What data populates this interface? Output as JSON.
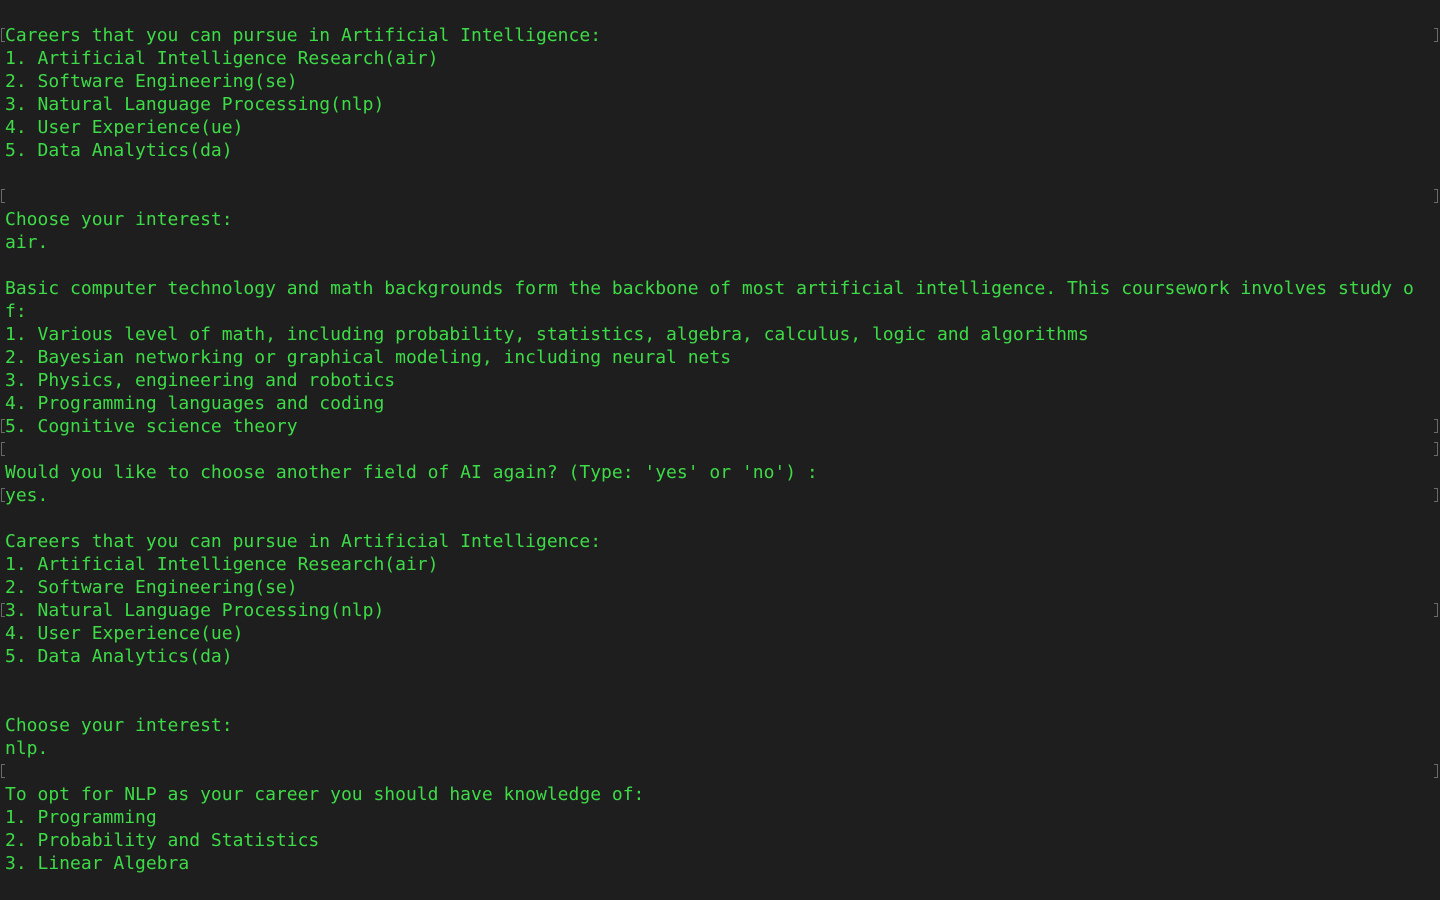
{
  "theme": {
    "background": "#1e1e1e",
    "text_color": "#3ddc47",
    "marker_color": "#6a6a6a"
  },
  "terminal": {
    "lines": [
      {
        "text": "Careers that you can pursue in Artificial Intelligence:",
        "marked": true
      },
      {
        "text": "1. Artificial Intelligence Research(air)",
        "marked": false
      },
      {
        "text": "2. Software Engineering(se)",
        "marked": false
      },
      {
        "text": "3. Natural Language Processing(nlp)",
        "marked": false
      },
      {
        "text": "4. User Experience(ue)",
        "marked": false
      },
      {
        "text": "5. Data Analytics(da)",
        "marked": false
      },
      {
        "text": "",
        "marked": false
      },
      {
        "text": "",
        "marked": true
      },
      {
        "text": "Choose your interest:",
        "marked": false
      },
      {
        "text": "air.",
        "marked": false
      },
      {
        "text": "",
        "marked": false
      },
      {
        "text": "Basic computer technology and math backgrounds form the backbone of most artificial intelligence. This coursework involves study o",
        "marked": false
      },
      {
        "text": "f:",
        "marked": false
      },
      {
        "text": "1. Various level of math, including probability, statistics, algebra, calculus, logic and algorithms",
        "marked": false
      },
      {
        "text": "2. Bayesian networking or graphical modeling, including neural nets",
        "marked": false
      },
      {
        "text": "3. Physics, engineering and robotics",
        "marked": false
      },
      {
        "text": "4. Programming languages and coding",
        "marked": false
      },
      {
        "text": "5. Cognitive science theory",
        "marked": true
      },
      {
        "text": "",
        "marked": true
      },
      {
        "text": "Would you like to choose another field of AI again? (Type: 'yes' or 'no') :",
        "marked": false
      },
      {
        "text": "yes.",
        "marked": true
      },
      {
        "text": "",
        "marked": false
      },
      {
        "text": "Careers that you can pursue in Artificial Intelligence:",
        "marked": false
      },
      {
        "text": "1. Artificial Intelligence Research(air)",
        "marked": false
      },
      {
        "text": "2. Software Engineering(se)",
        "marked": false
      },
      {
        "text": "3. Natural Language Processing(nlp)",
        "marked": true
      },
      {
        "text": "4. User Experience(ue)",
        "marked": false
      },
      {
        "text": "5. Data Analytics(da)",
        "marked": false
      },
      {
        "text": "",
        "marked": false
      },
      {
        "text": "",
        "marked": false
      },
      {
        "text": "Choose your interest:",
        "marked": false
      },
      {
        "text": "nlp.",
        "marked": false
      },
      {
        "text": "",
        "marked": true
      },
      {
        "text": "To opt for NLP as your career you should have knowledge of:",
        "marked": false
      },
      {
        "text": "1. Programming",
        "marked": false
      },
      {
        "text": "2. Probability and Statistics",
        "marked": false
      },
      {
        "text": "3. Linear Algebra",
        "marked": false
      }
    ]
  }
}
